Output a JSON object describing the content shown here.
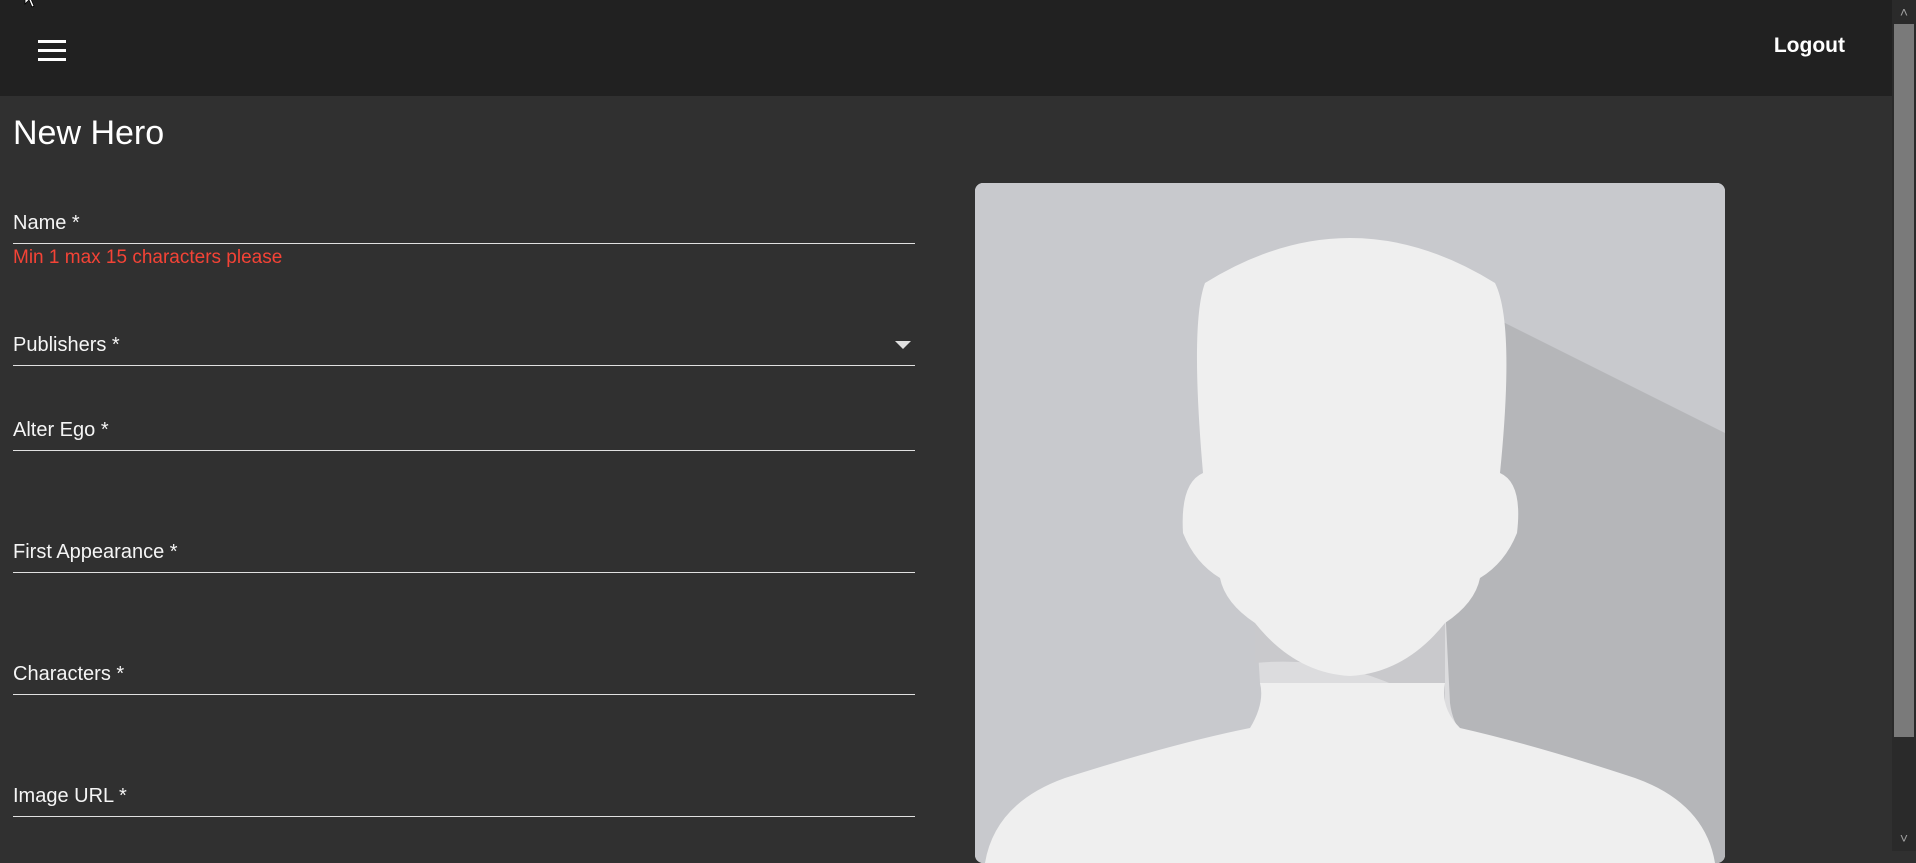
{
  "toolbar": {
    "menu_icon": "hamburger-menu-icon",
    "logout_label": "Logout"
  },
  "page": {
    "title": "New Hero"
  },
  "form": {
    "name_label": "Name *",
    "name_error": "Min 1 max 15 characters please",
    "publishers_label": "Publishers *",
    "alter_ego_label": "Alter Ego *",
    "first_appearance_label": "First Appearance *",
    "characters_label": "Characters *",
    "image_url_label": "Image URL *"
  },
  "colors": {
    "background": "#303030",
    "toolbar": "#212121",
    "error": "#f44336"
  }
}
